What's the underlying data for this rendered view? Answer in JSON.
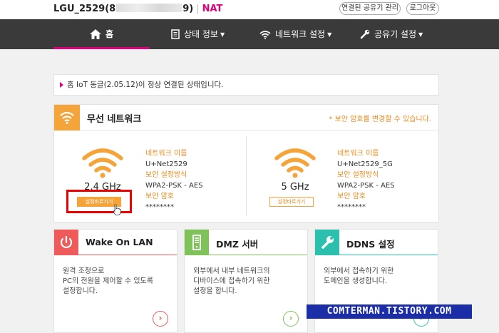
{
  "header": {
    "device_prefix": "LGU_2529(8",
    "device_suffix": "9)",
    "separator": "|",
    "mode": "NAT",
    "shared_devices_button": "연결된 공유기 관리",
    "logout_button": "로그아웃"
  },
  "nav": {
    "home": "홈",
    "status": "상태 정보",
    "network": "네트워크 설정",
    "router": "공유기 설정"
  },
  "notice": "홈 IoT 동글(2.05.12)이 정상 연결된 상태입니다.",
  "wireless": {
    "title": "무선 네트워크",
    "note": "* 보안 암호를 변경할 수 있습니다.",
    "bands": [
      {
        "freq": "2.4 GHz",
        "button": "설정바로가기",
        "name_label": "네트워크 이름",
        "name": "U+Net2529",
        "security_label": "보안 설정방식",
        "security": "WPA2-PSK - AES",
        "password_label": "보안 암호",
        "password": "********"
      },
      {
        "freq": "5 GHz",
        "button": "설정바로가기",
        "name_label": "네트워크 이름",
        "name": "U+Net2529_5G",
        "security_label": "보안 설정방식",
        "security": "WPA2-PSK - AES",
        "password_label": "보안 암호",
        "password": "********"
      }
    ]
  },
  "cards": [
    {
      "title": "Wake On LAN",
      "desc": "원격 조정으로\nPC의 전원을 제어할 수 있도록\n설정합니다.",
      "arrow": "›"
    },
    {
      "title": "DMZ 서버",
      "desc": "외부에서 내부 네트워크의\n디바이스에 접속하기 위한\n설정을 합니다.",
      "arrow": "›"
    },
    {
      "title": "DDNS 설정",
      "desc": "외부에서 접속하기 위한\n도메인을 생성합니다.",
      "arrow": "›"
    }
  ],
  "watermark": "COMTERMAN.TISTORY.COM",
  "colors": {
    "accent_pink": "#e0007a",
    "wifi_orange": "#f5a43a",
    "wol_red": "#ef5a5a",
    "dmz_green": "#7fc25a",
    "ddns_teal": "#2bbfae",
    "nav_bg": "#3a3a3a"
  },
  "icons": {
    "home": "home-icon",
    "status": "document-icon",
    "network": "wifi-icon",
    "router": "wrench-icon",
    "wol": "power-icon",
    "dmz": "server-icon",
    "ddns": "wrench-icon"
  }
}
